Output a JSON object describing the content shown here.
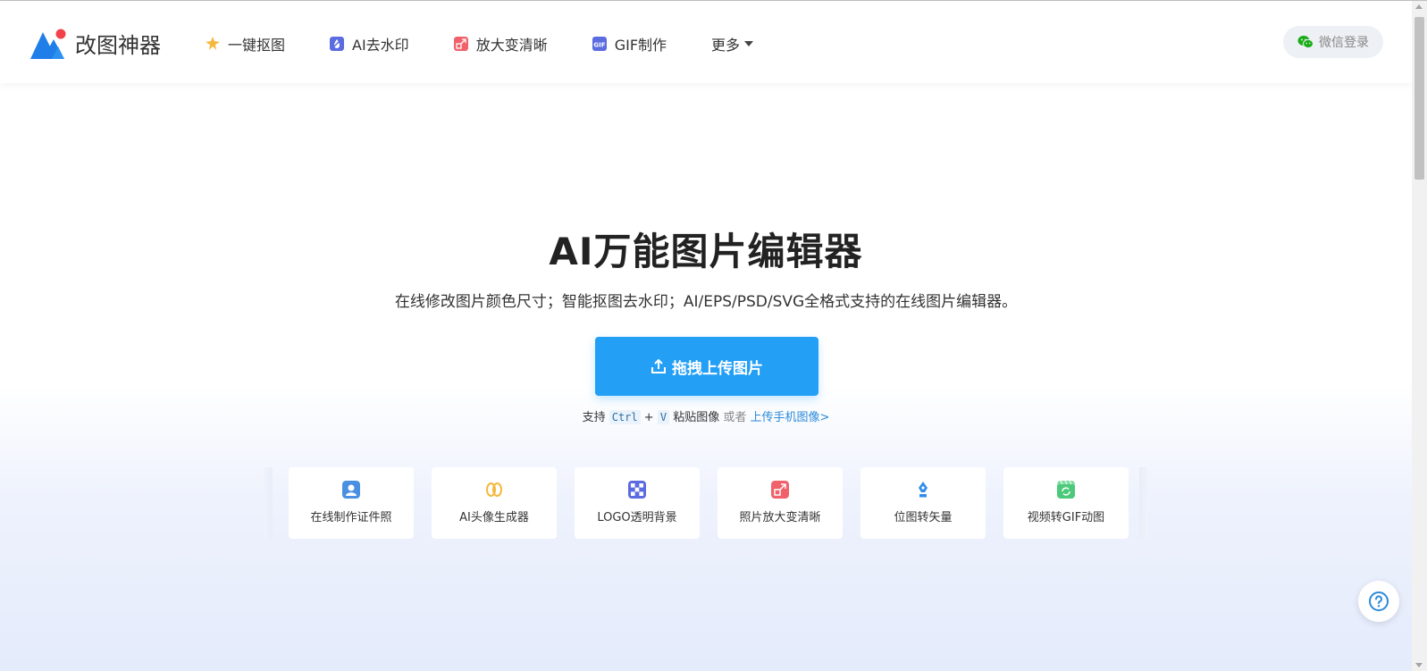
{
  "brand": {
    "name": "改图神器"
  },
  "nav": {
    "items": [
      {
        "label": "一键抠图",
        "icon": "magic-wand-icon"
      },
      {
        "label": "AI去水印",
        "icon": "watermark-icon"
      },
      {
        "label": "放大变清晰",
        "icon": "enlarge-icon"
      },
      {
        "label": "GIF制作",
        "icon": "gif-icon"
      },
      {
        "label": "更多",
        "icon": "chevron-down-icon"
      }
    ],
    "login_label": "微信登录"
  },
  "hero": {
    "title": "AI万能图片编辑器",
    "subtitle": "在线修改图片颜色尺寸；智能抠图去水印；AI/EPS/PSD/SVG全格式支持的在线图片编辑器。",
    "upload_label": "拖拽上传图片",
    "paste_prefix": "支持",
    "key_ctrl": "Ctrl",
    "key_plus": "+",
    "key_v": "V",
    "paste_suffix": "粘贴图像",
    "or_text": "或者",
    "mobile_link": "上传手机图像>"
  },
  "tools": [
    {
      "label": "在线制作证件照",
      "icon": "id-photo-icon",
      "color": "#4a90e2"
    },
    {
      "label": "AI头像生成器",
      "icon": "avatar-generator-icon",
      "color": "#f5b83d"
    },
    {
      "label": "LOGO透明背景",
      "icon": "transparent-bg-icon",
      "color": "#5b6be0"
    },
    {
      "label": "照片放大变清晰",
      "icon": "enlarge-icon",
      "color": "#f0616a"
    },
    {
      "label": "位图转矢量",
      "icon": "vector-pen-icon",
      "color": "#2f8ee8"
    },
    {
      "label": "视频转GIF动图",
      "icon": "video-gif-icon",
      "color": "#4cc97a"
    }
  ],
  "colors": {
    "accent": "#239ff6",
    "link": "#2b8ad9"
  }
}
